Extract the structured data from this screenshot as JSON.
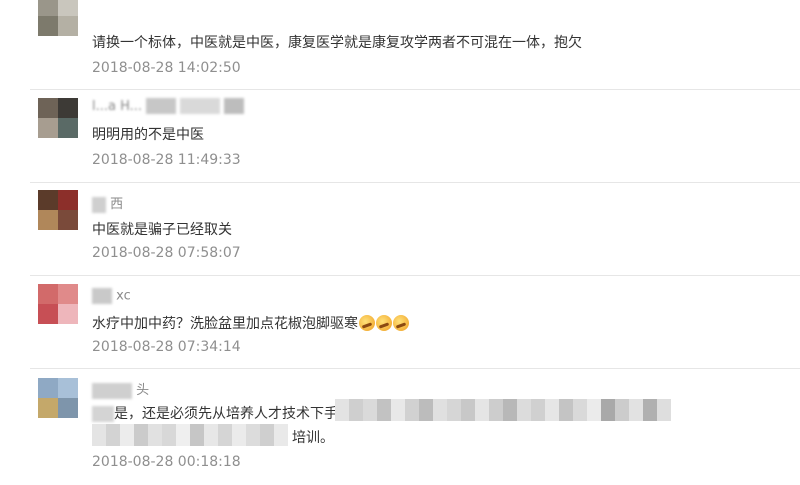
{
  "comments": [
    {
      "username": "",
      "text": "请换一个标体，中医就是中医，康复医学就是康复攻学两者不可混在一体，抱欠",
      "time": "2018-08-28 14:02:50"
    },
    {
      "username": "l...a H...",
      "text": "明明用的不是中医",
      "time": "2018-08-28 11:49:33"
    },
    {
      "username": "西",
      "text": "中医就是骗子已经取关",
      "time": "2018-08-28 07:58:07"
    },
    {
      "username": "xc",
      "text": "水疗中加中药？洗脸盆里加点花椒泡脚驱寒",
      "emoji": "crying-laughing-emoji",
      "time": "2018-08-28 07:34:14"
    },
    {
      "username": "头",
      "text_line1": "是，还是必须先从培养人才技术下手。",
      "text_line2": "培训。",
      "time": "2018-08-28 00:18:18"
    }
  ],
  "colors": {
    "divider": "#e6e6e6",
    "text": "#333333",
    "time": "#8f8f8f",
    "username": "#8a8a8a"
  }
}
